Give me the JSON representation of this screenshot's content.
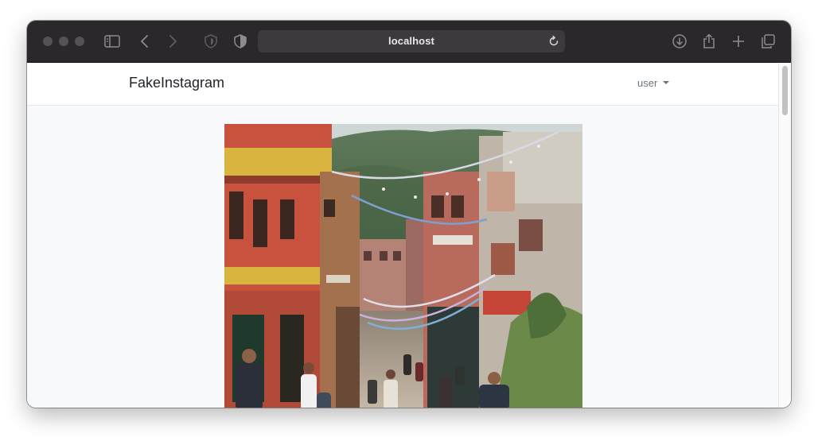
{
  "browser": {
    "url": "localhost",
    "icons": [
      "close-light",
      "minimize-light",
      "zoom-light",
      "sidebar-icon",
      "back-icon",
      "forward-icon",
      "shield-icon",
      "privacy-icon",
      "reload-icon",
      "download-icon",
      "share-icon",
      "new-tab-icon",
      "tabs-overview-icon"
    ]
  },
  "navbar": {
    "brand": "FakeInstagram",
    "user_menu": "user"
  },
  "post": {
    "image": "street-photo"
  },
  "colors": {
    "titlebar": "#2b282c",
    "page_bg": "#f8f9fa",
    "navbar_bg": "#ffffff"
  }
}
